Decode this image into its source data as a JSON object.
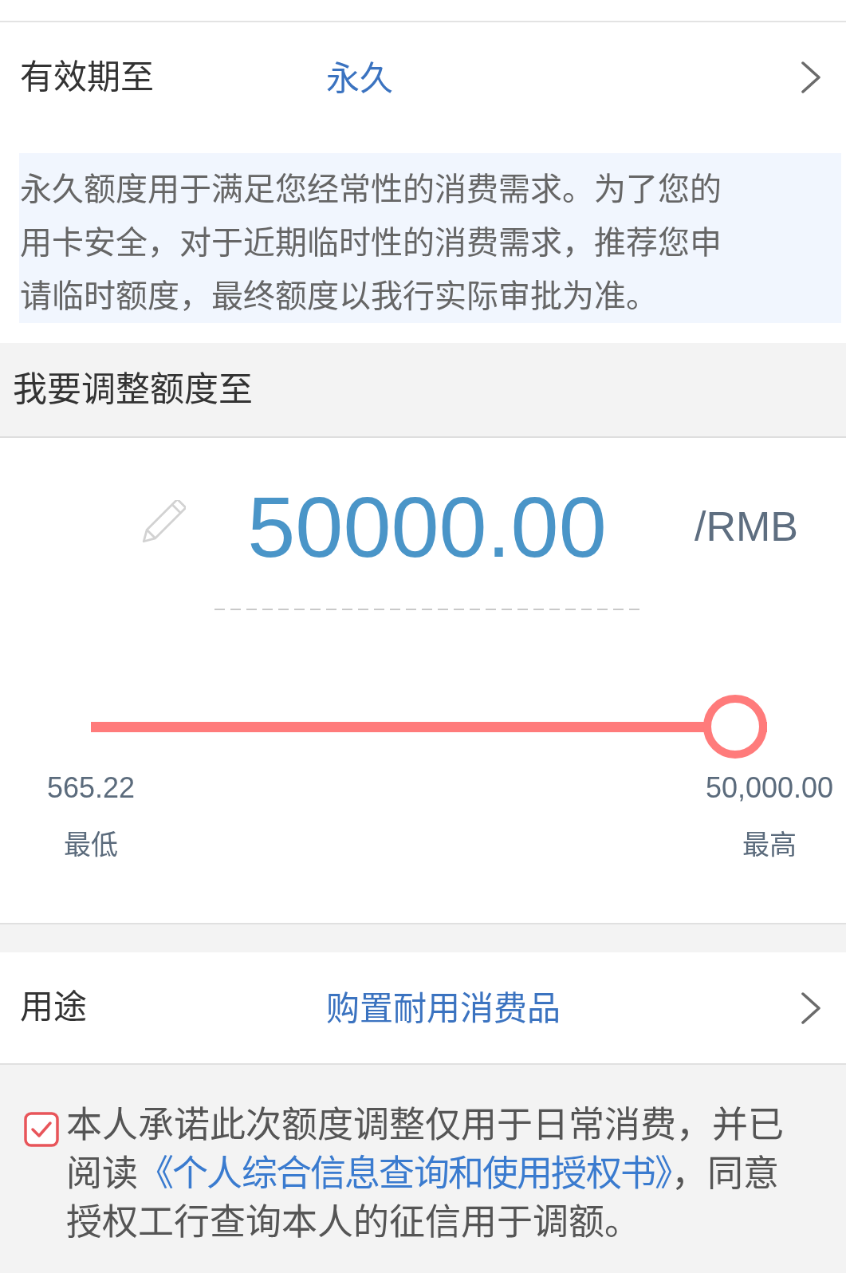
{
  "validity_row": {
    "label": "有效期至",
    "value": "永久"
  },
  "note": "永久额度用于满足您经常性的消费需求。为了您的用卡安全，对于近期临时性的消费需求，推荐您申请临时额度，最终额度以我行实际审批为准。",
  "adjust_section": {
    "title": "我要调整额度至"
  },
  "amount": {
    "value": "50000.00",
    "unit": "/RMB"
  },
  "slider": {
    "level": 1,
    "min": {
      "value": "565.22",
      "label": "最低"
    },
    "max": {
      "value": "50,000.00",
      "label": "最高"
    }
  },
  "purpose_row": {
    "label": "用途",
    "value": "购置耐用消费品"
  },
  "consent": {
    "checked": true,
    "text_before": "本人承诺此次额度调整仅用于日常消费，并已阅读",
    "link": "《个人综合信息查询和使用授权书》",
    "text_after": "，同意授权工行查询本人的征信用于调额。"
  }
}
